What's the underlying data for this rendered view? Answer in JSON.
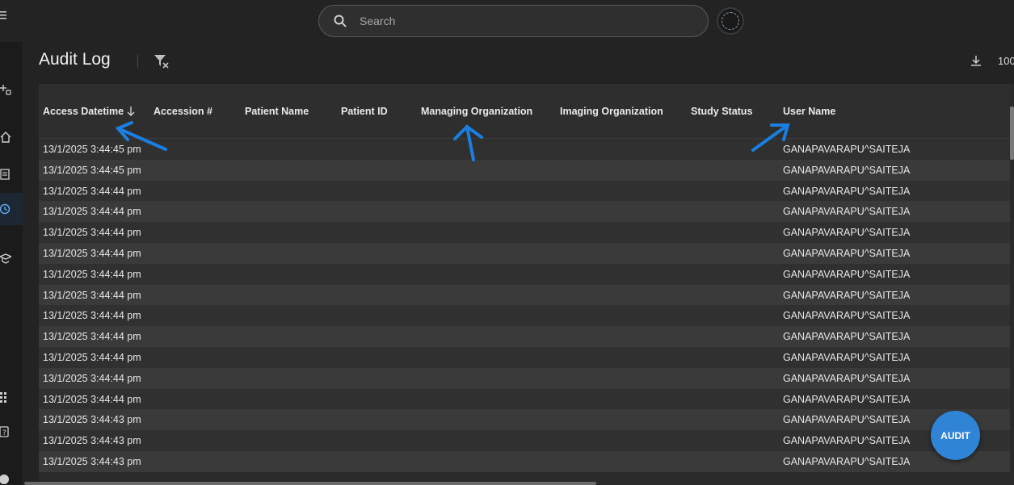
{
  "topbar": {
    "search": {
      "placeholder": "Search",
      "value": ""
    },
    "menu_icon": "menu-icon",
    "avatar_icon": "avatar"
  },
  "sidebar": {
    "items": [
      {
        "icon": "add-database-icon"
      },
      {
        "icon": "home-icon"
      },
      {
        "icon": "list-icon"
      },
      {
        "icon": "history-icon",
        "active": true
      },
      {
        "icon": "graduation-cap-icon"
      },
      {
        "icon": "apps-grid-icon"
      },
      {
        "icon": "help-icon"
      },
      {
        "icon": "user-icon"
      }
    ]
  },
  "header": {
    "title": "Audit Log",
    "filter_clear_icon": "filter-clear-icon",
    "download_icon": "download-icon",
    "page_size": "100"
  },
  "table": {
    "columns": [
      "Access Datetime",
      "Accession #",
      "Patient Name",
      "Patient ID",
      "Managing Organization",
      "Imaging Organization",
      "Study Status",
      "User Name"
    ],
    "sort": {
      "column": "Access Datetime",
      "direction": "desc"
    },
    "rows": [
      {
        "access_datetime": "13/1/2025 3:44:45 pm",
        "user_name": "GANAPAVARAPU^SAITEJA"
      },
      {
        "access_datetime": "13/1/2025 3:44:45 pm",
        "user_name": "GANAPAVARAPU^SAITEJA"
      },
      {
        "access_datetime": "13/1/2025 3:44:44 pm",
        "user_name": "GANAPAVARAPU^SAITEJA"
      },
      {
        "access_datetime": "13/1/2025 3:44:44 pm",
        "user_name": "GANAPAVARAPU^SAITEJA"
      },
      {
        "access_datetime": "13/1/2025 3:44:44 pm",
        "user_name": "GANAPAVARAPU^SAITEJA"
      },
      {
        "access_datetime": "13/1/2025 3:44:44 pm",
        "user_name": "GANAPAVARAPU^SAITEJA"
      },
      {
        "access_datetime": "13/1/2025 3:44:44 pm",
        "user_name": "GANAPAVARAPU^SAITEJA"
      },
      {
        "access_datetime": "13/1/2025 3:44:44 pm",
        "user_name": "GANAPAVARAPU^SAITEJA"
      },
      {
        "access_datetime": "13/1/2025 3:44:44 pm",
        "user_name": "GANAPAVARAPU^SAITEJA"
      },
      {
        "access_datetime": "13/1/2025 3:44:44 pm",
        "user_name": "GANAPAVARAPU^SAITEJA"
      },
      {
        "access_datetime": "13/1/2025 3:44:44 pm",
        "user_name": "GANAPAVARAPU^SAITEJA"
      },
      {
        "access_datetime": "13/1/2025 3:44:44 pm",
        "user_name": "GANAPAVARAPU^SAITEJA"
      },
      {
        "access_datetime": "13/1/2025 3:44:44 pm",
        "user_name": "GANAPAVARAPU^SAITEJA"
      },
      {
        "access_datetime": "13/1/2025 3:44:43 pm",
        "user_name": "GANAPAVARAPU^SAITEJA"
      },
      {
        "access_datetime": "13/1/2025 3:44:43 pm",
        "user_name": "GANAPAVARAPU^SAITEJA"
      },
      {
        "access_datetime": "13/1/2025 3:44:43 pm",
        "user_name": "GANAPAVARAPU^SAITEJA"
      }
    ]
  },
  "fab": {
    "label": "AUDIT"
  },
  "colors": {
    "background": "#232323",
    "row_odd": "#303030",
    "row_even": "#3a3a3a",
    "accent": "#2f84d6",
    "annotation_arrow": "#1a7fe0"
  }
}
